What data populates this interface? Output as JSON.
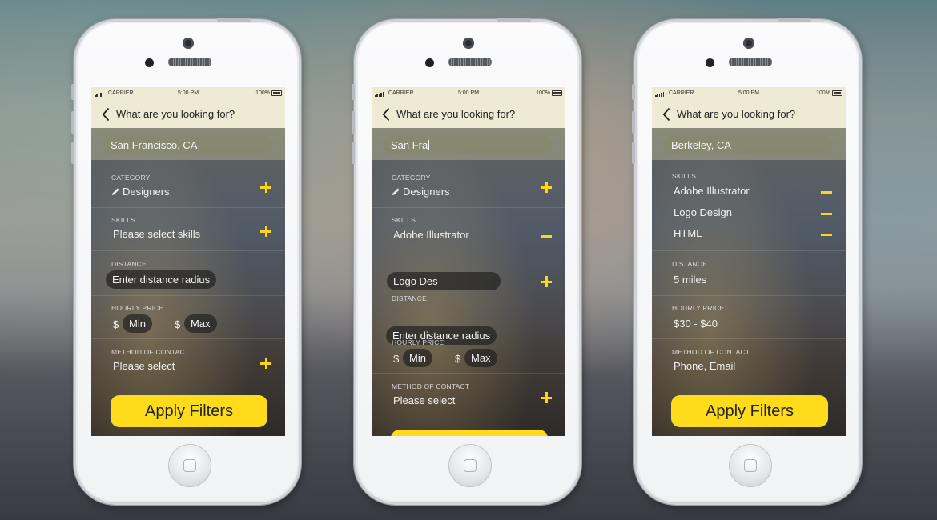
{
  "colors": {
    "accent": "#fedc1c",
    "header_bg": "#eeead3"
  },
  "phones": [
    {
      "status": {
        "carrier": "CARRIER",
        "time": "5:00 PM",
        "battery": "100%"
      },
      "nav": {
        "title": "What are you looking for?"
      },
      "search": {
        "value": "San Francisco, CA"
      },
      "category": {
        "label": "CATEGORY",
        "value": "Designers",
        "icon": "pencil-icon"
      },
      "skills": {
        "label": "SKILLS",
        "value": "Please select skills"
      },
      "distance": {
        "label": "DISTANCE",
        "placeholder": "Enter distance radius"
      },
      "price": {
        "label": "HOURLY PRICE",
        "currency": "$",
        "min": "Min",
        "max": "Max"
      },
      "contact": {
        "label": "METHOD OF CONTACT",
        "value": "Please select"
      },
      "apply_label": "Apply Filters"
    },
    {
      "status": {
        "carrier": "CARRIER",
        "time": "5:00 PM",
        "battery": "100%"
      },
      "nav": {
        "title": "What are you looking for?"
      },
      "search": {
        "value": "San Fra"
      },
      "category": {
        "label": "CATEGORY",
        "value": "Designers",
        "icon": "pencil-icon"
      },
      "skills": {
        "label": "SKILLS",
        "items": [
          "Adobe Illustrator"
        ],
        "input": "Logo Des"
      },
      "distance": {
        "label": "DISTANCE",
        "placeholder": "Enter distance radius"
      },
      "price": {
        "label": "HOURLY PRICE",
        "currency": "$",
        "min": "Min",
        "max": "Max"
      },
      "contact": {
        "label": "METHOD OF CONTACT",
        "value": "Please select"
      },
      "apply_label": ""
    },
    {
      "status": {
        "carrier": "CARRIER",
        "time": "5:00 PM",
        "battery": "100%"
      },
      "nav": {
        "title": "What are you looking for?"
      },
      "search": {
        "value": "Berkeley, CA"
      },
      "skills": {
        "label": "SKILLS",
        "items": [
          "Adobe Illustrator",
          "Logo Design",
          "HTML"
        ]
      },
      "distance": {
        "label": "DISTANCE",
        "value": "5 miles"
      },
      "price": {
        "label": "HOURLY PRICE",
        "value": "$30  - $40"
      },
      "contact": {
        "label": "METHOD OF CONTACT",
        "value": "Phone, Email"
      },
      "apply_label": "Apply Filters"
    }
  ]
}
